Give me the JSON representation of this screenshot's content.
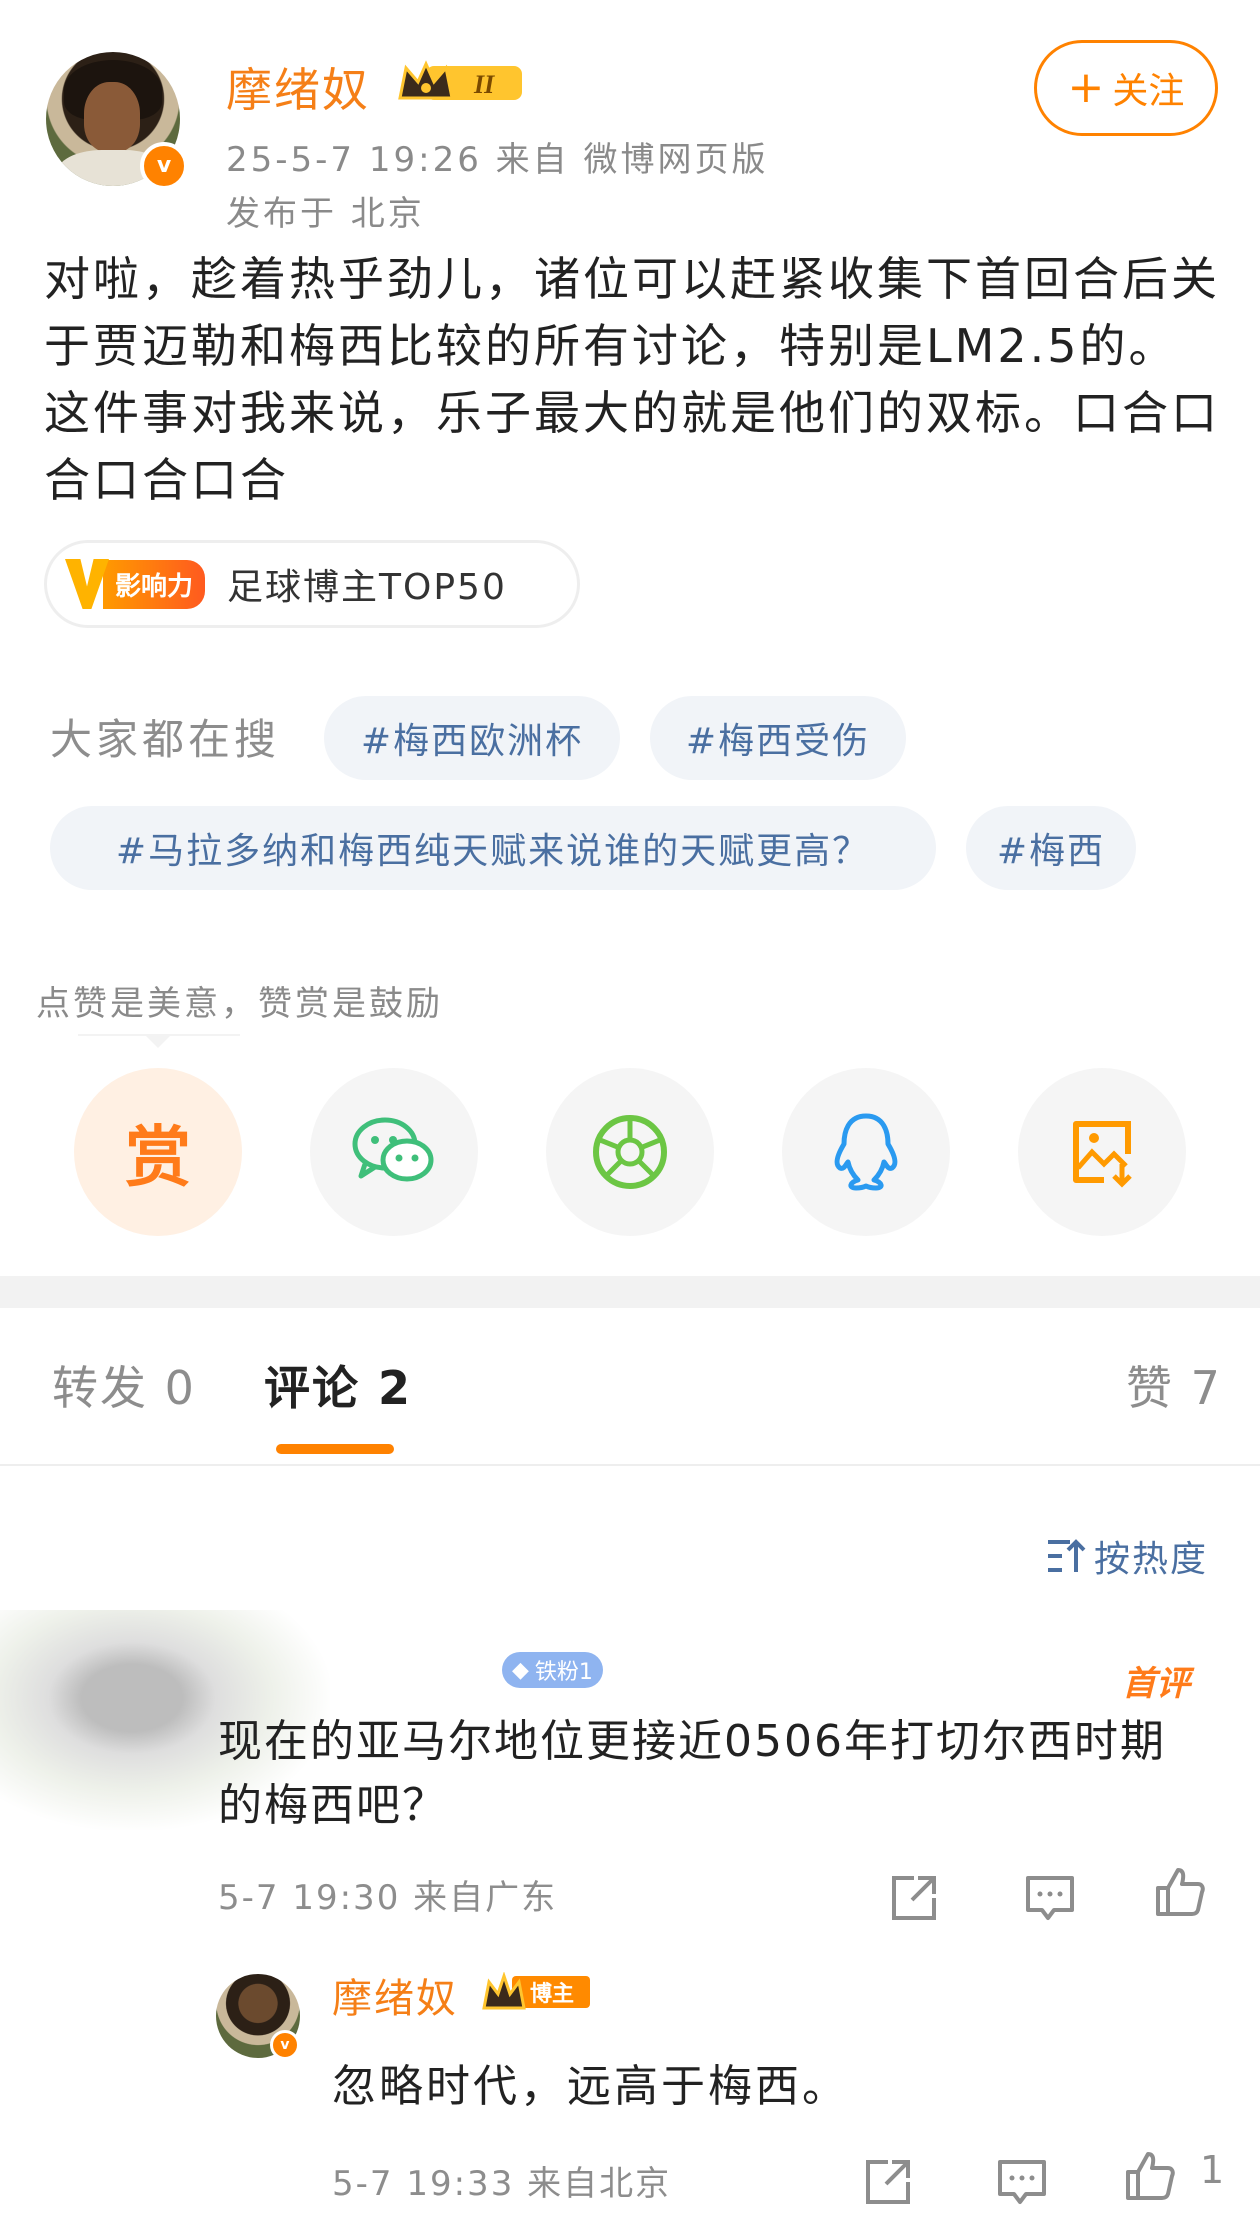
{
  "post": {
    "author": "摩绪奴",
    "member_level": "II",
    "time_source": "25-5-7 19:26  来自 微博网页版",
    "location": "发布于 北京",
    "follow_label": "关注",
    "text": "对啦，趁着热乎劲儿，诸位可以赶紧收集下首回合后关于贾迈勒和梅西比较的所有讨论，特别是LM2.5的。这件事对我来说，乐子最大的就是他们的双标。口合口合口合口合",
    "influence_badge": "影响力",
    "influence_text": "足球博主TOP50"
  },
  "hot_search": {
    "label": "大家都在搜",
    "chips": [
      "#梅西欧洲杯",
      "#梅西受伤",
      "#马拉多纳和梅西纯天赋来说谁的天赋更高？",
      "#梅西"
    ]
  },
  "reward": {
    "hint": "点赞是美意，赞赏是鼓励",
    "reward_glyph": "赏"
  },
  "share_icons": [
    "reward-icon",
    "wechat-icon",
    "moments-icon",
    "qq-icon",
    "save-image-icon"
  ],
  "colors": {
    "accent": "#ff8200",
    "link": "#4a6fa1",
    "wechat": "#3fbf7a",
    "moments": "#6cc644",
    "qq": "#2a9af0",
    "save": "#ff9a00"
  },
  "tabs": {
    "repost": "转发 0",
    "comment": "评论 2",
    "like": "赞 7"
  },
  "sort_label": "按热度",
  "comments": [
    {
      "fan_badge": "铁粉1",
      "first_badge": "首评",
      "text": "现在的亚马尔地位更接近0506年打切尔西时期的梅西吧？",
      "meta": "5-7 19:30  来自广东"
    }
  ],
  "reply": {
    "author": "摩绪奴",
    "role_badge": "博主",
    "text": "忽略时代，远高于梅西。",
    "meta": "5-7 19:33  来自北京",
    "like_count": "1"
  }
}
